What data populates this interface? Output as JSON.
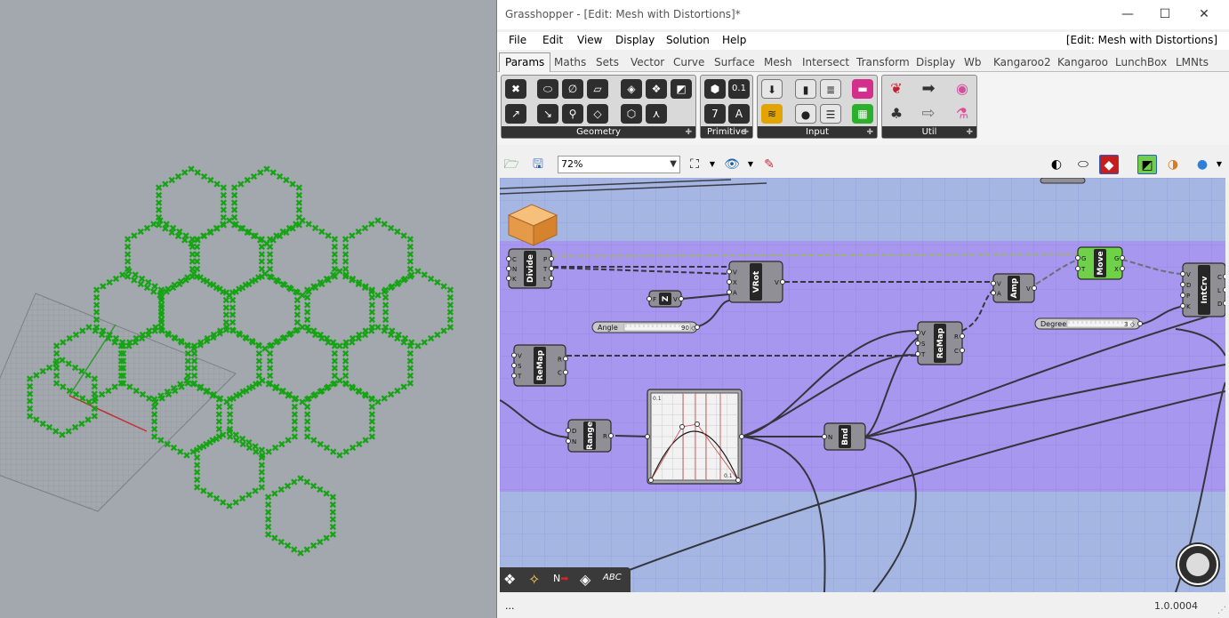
{
  "window": {
    "title": "Grasshopper - [Edit: Mesh with Distortions]*",
    "minimize": "—",
    "maximize": "☐",
    "close": "✕"
  },
  "menu": {
    "items": [
      "File",
      "Edit",
      "View",
      "Display",
      "Solution",
      "Help"
    ],
    "right_title": "[Edit: Mesh with Distortions]"
  },
  "tabs": [
    "Params",
    "Maths",
    "Sets",
    "Vector",
    "Curve",
    "Surface",
    "Mesh",
    "Intersect",
    "Transform",
    "Display",
    "Wb",
    "Kangaroo2",
    "Kangaroo",
    "LunchBox",
    "LMNts"
  ],
  "ribbon": {
    "panels": [
      {
        "label": "Geometry"
      },
      {
        "label": "Primitive"
      },
      {
        "label": "Input"
      },
      {
        "label": "Util"
      }
    ],
    "primitive_glyphs": [
      "0.1",
      "7",
      "A"
    ]
  },
  "toolbar": {
    "zoom": "72%"
  },
  "canvas": {
    "nodes": {
      "divide": {
        "name": "Divide",
        "inputs": [
          "C",
          "N",
          "K"
        ],
        "outputs": [
          "P",
          "T",
          "t"
        ]
      },
      "vrot": {
        "name": "VRot",
        "inputs": [
          "V",
          "X",
          "A"
        ],
        "outputs": [
          "V"
        ]
      },
      "z": {
        "name": "Z",
        "inputs": [
          "F"
        ],
        "outputs": [
          "V"
        ]
      },
      "angle": {
        "label": "Angle",
        "value": "90"
      },
      "amp": {
        "name": "Amp",
        "inputs": [
          "V",
          "A"
        ],
        "outputs": [
          "V"
        ]
      },
      "move": {
        "name": "Move",
        "inputs": [
          "G",
          "T"
        ],
        "outputs": [
          "G",
          "X"
        ]
      },
      "intcrv": {
        "name": "IntCrv",
        "inputs": [
          "V",
          "D",
          "P",
          "K"
        ],
        "outputs": [
          "C",
          "L",
          "D"
        ]
      },
      "degree": {
        "label": "Degree",
        "value": "3"
      },
      "remap1": {
        "name": "ReMap",
        "inputs": [
          "V",
          "S",
          "T"
        ],
        "outputs": [
          "R",
          "C"
        ]
      },
      "remap2": {
        "name": "ReMap",
        "inputs": [
          "V",
          "S",
          "T"
        ],
        "outputs": [
          "R",
          "C"
        ]
      },
      "range": {
        "name": "Range",
        "inputs": [
          "D",
          "N"
        ],
        "outputs": [
          "R"
        ]
      },
      "bnd": {
        "name": "Bnd",
        "inputs": [
          "N"
        ],
        "outputs": []
      },
      "graph": {
        "corner_top": "0.1",
        "corner_bottom": "0.1"
      }
    },
    "colors": {
      "canvas": "#a6b6e2",
      "group": "#a797ee",
      "node": "#8f8f95",
      "move_node": "#6fd147"
    }
  },
  "statusbar": {
    "left": "...",
    "version": "1.0.0004"
  }
}
